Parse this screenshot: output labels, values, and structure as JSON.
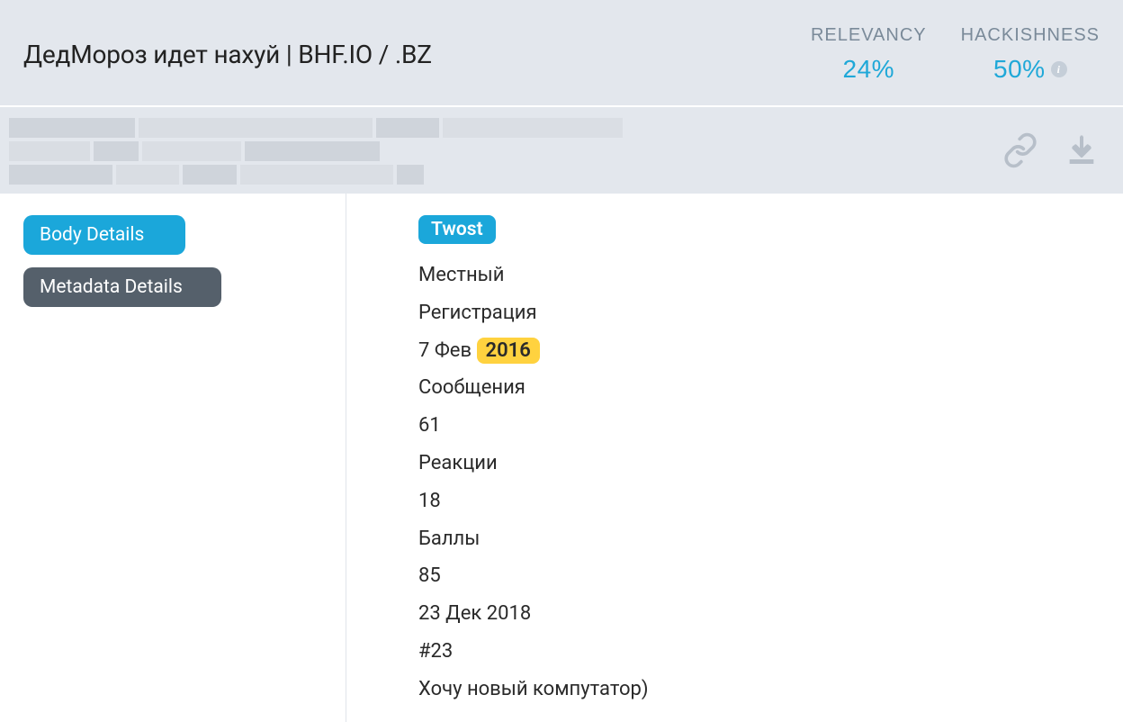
{
  "header": {
    "title": "ДедМороз идет нахуй | BHF.IO / .BZ",
    "metrics": {
      "relevancy": {
        "label": "RELEVANCY",
        "value": "24%"
      },
      "hackishness": {
        "label": "HACKISHNESS",
        "value": "50%"
      }
    }
  },
  "sidebar": {
    "tabs": [
      {
        "label": "Body Details"
      },
      {
        "label": "Metadata Details"
      }
    ]
  },
  "post": {
    "author_badge": "Twost",
    "lines": [
      "Местный",
      "Регистрация"
    ],
    "reg_date_prefix": "7 Фев ",
    "reg_date_highlight": "2016",
    "stats": [
      "Сообщения",
      "61",
      "Реакции",
      "18",
      "Баллы",
      "85",
      "23 Дек 2018",
      "#23",
      "Хочу новый компутатор)"
    ]
  }
}
